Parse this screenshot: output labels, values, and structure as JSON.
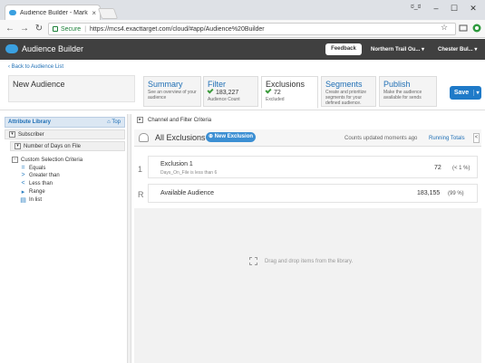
{
  "browser": {
    "tab_title": "Audience Builder - Mark",
    "tab_close": "×",
    "window_user": "ಠ_ಠ",
    "url_secure": "Secure",
    "url": "https://mcs4.exacttarget.com/cloud/#app/Audience%20Builder"
  },
  "app": {
    "title": "Audience Builder",
    "feedback": "Feedback",
    "business_unit": "Northern Trail Ou... ▾",
    "user": "Chester Bul... ▾"
  },
  "header": {
    "back_link": "Back to Audience List",
    "audience_name": "New Audience",
    "save_label": "Save",
    "save_caret": "▾"
  },
  "steps": [
    {
      "title": "Summary",
      "sub": "See an overview of your audience",
      "value": ""
    },
    {
      "title": "Filter",
      "sub": "Audience Count",
      "value": "183,227"
    },
    {
      "title": "Exclusions",
      "sub": "Excluded",
      "value": "72"
    },
    {
      "title": "Segments",
      "sub": "Create and prioritize segments for your defined audience.",
      "value": ""
    },
    {
      "title": "Publish",
      "sub": "Make the audience available for sends",
      "value": ""
    }
  ],
  "library": {
    "title": "Attribute Library",
    "top": "Top",
    "items": [
      "Subscriber",
      "Number of Days on File",
      "Custom Selection Criteria"
    ],
    "operators": [
      "Equals",
      "Greater than",
      "Less than",
      "Range",
      "In list"
    ]
  },
  "main": {
    "criteria_header": "Channel and Filter Criteria",
    "exclusions_title": "All Exclusions",
    "new_exclusion": "New Exclusion",
    "counts_updated": "Counts updated moments ago",
    "running_totals": "Running Totals",
    "collapse": "<",
    "rows": [
      {
        "index": "1",
        "name": "Exclusion 1",
        "detail": "Days_On_File is less than  6",
        "count": "72",
        "pct": "(< 1 %)"
      },
      {
        "index": "R",
        "name": "Available Audience",
        "detail": "",
        "count": "183,155",
        "pct": "(99 %)"
      }
    ],
    "drop_message": "Drag and drop items from the library."
  }
}
